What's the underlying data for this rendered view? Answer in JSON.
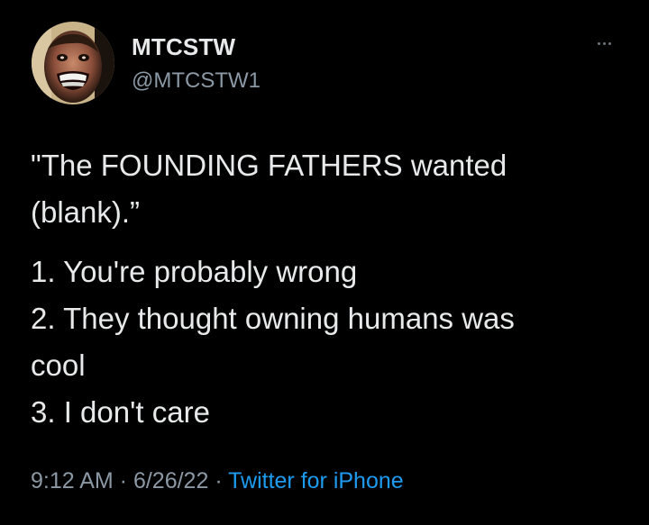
{
  "author": {
    "display_name": "MTCSTW",
    "handle": "@MTCSTW1"
  },
  "more_icon": "more-horizontal-icon",
  "tweet": {
    "lines_first": [
      "\"The FOUNDING FATHERS wanted",
      "(blank).”"
    ],
    "lines_second": [
      "1. You're probably wrong",
      "2. They thought owning humans was",
      "cool",
      "3. I don't care"
    ]
  },
  "meta": {
    "time": "9:12 AM",
    "sep1": " · ",
    "date": "6/26/22",
    "sep2": " · ",
    "source": "Twitter for iPhone"
  },
  "colors": {
    "background": "#000000",
    "text": "#e7e9ea",
    "secondary": "#8b98a5",
    "link": "#1d9bf0"
  }
}
